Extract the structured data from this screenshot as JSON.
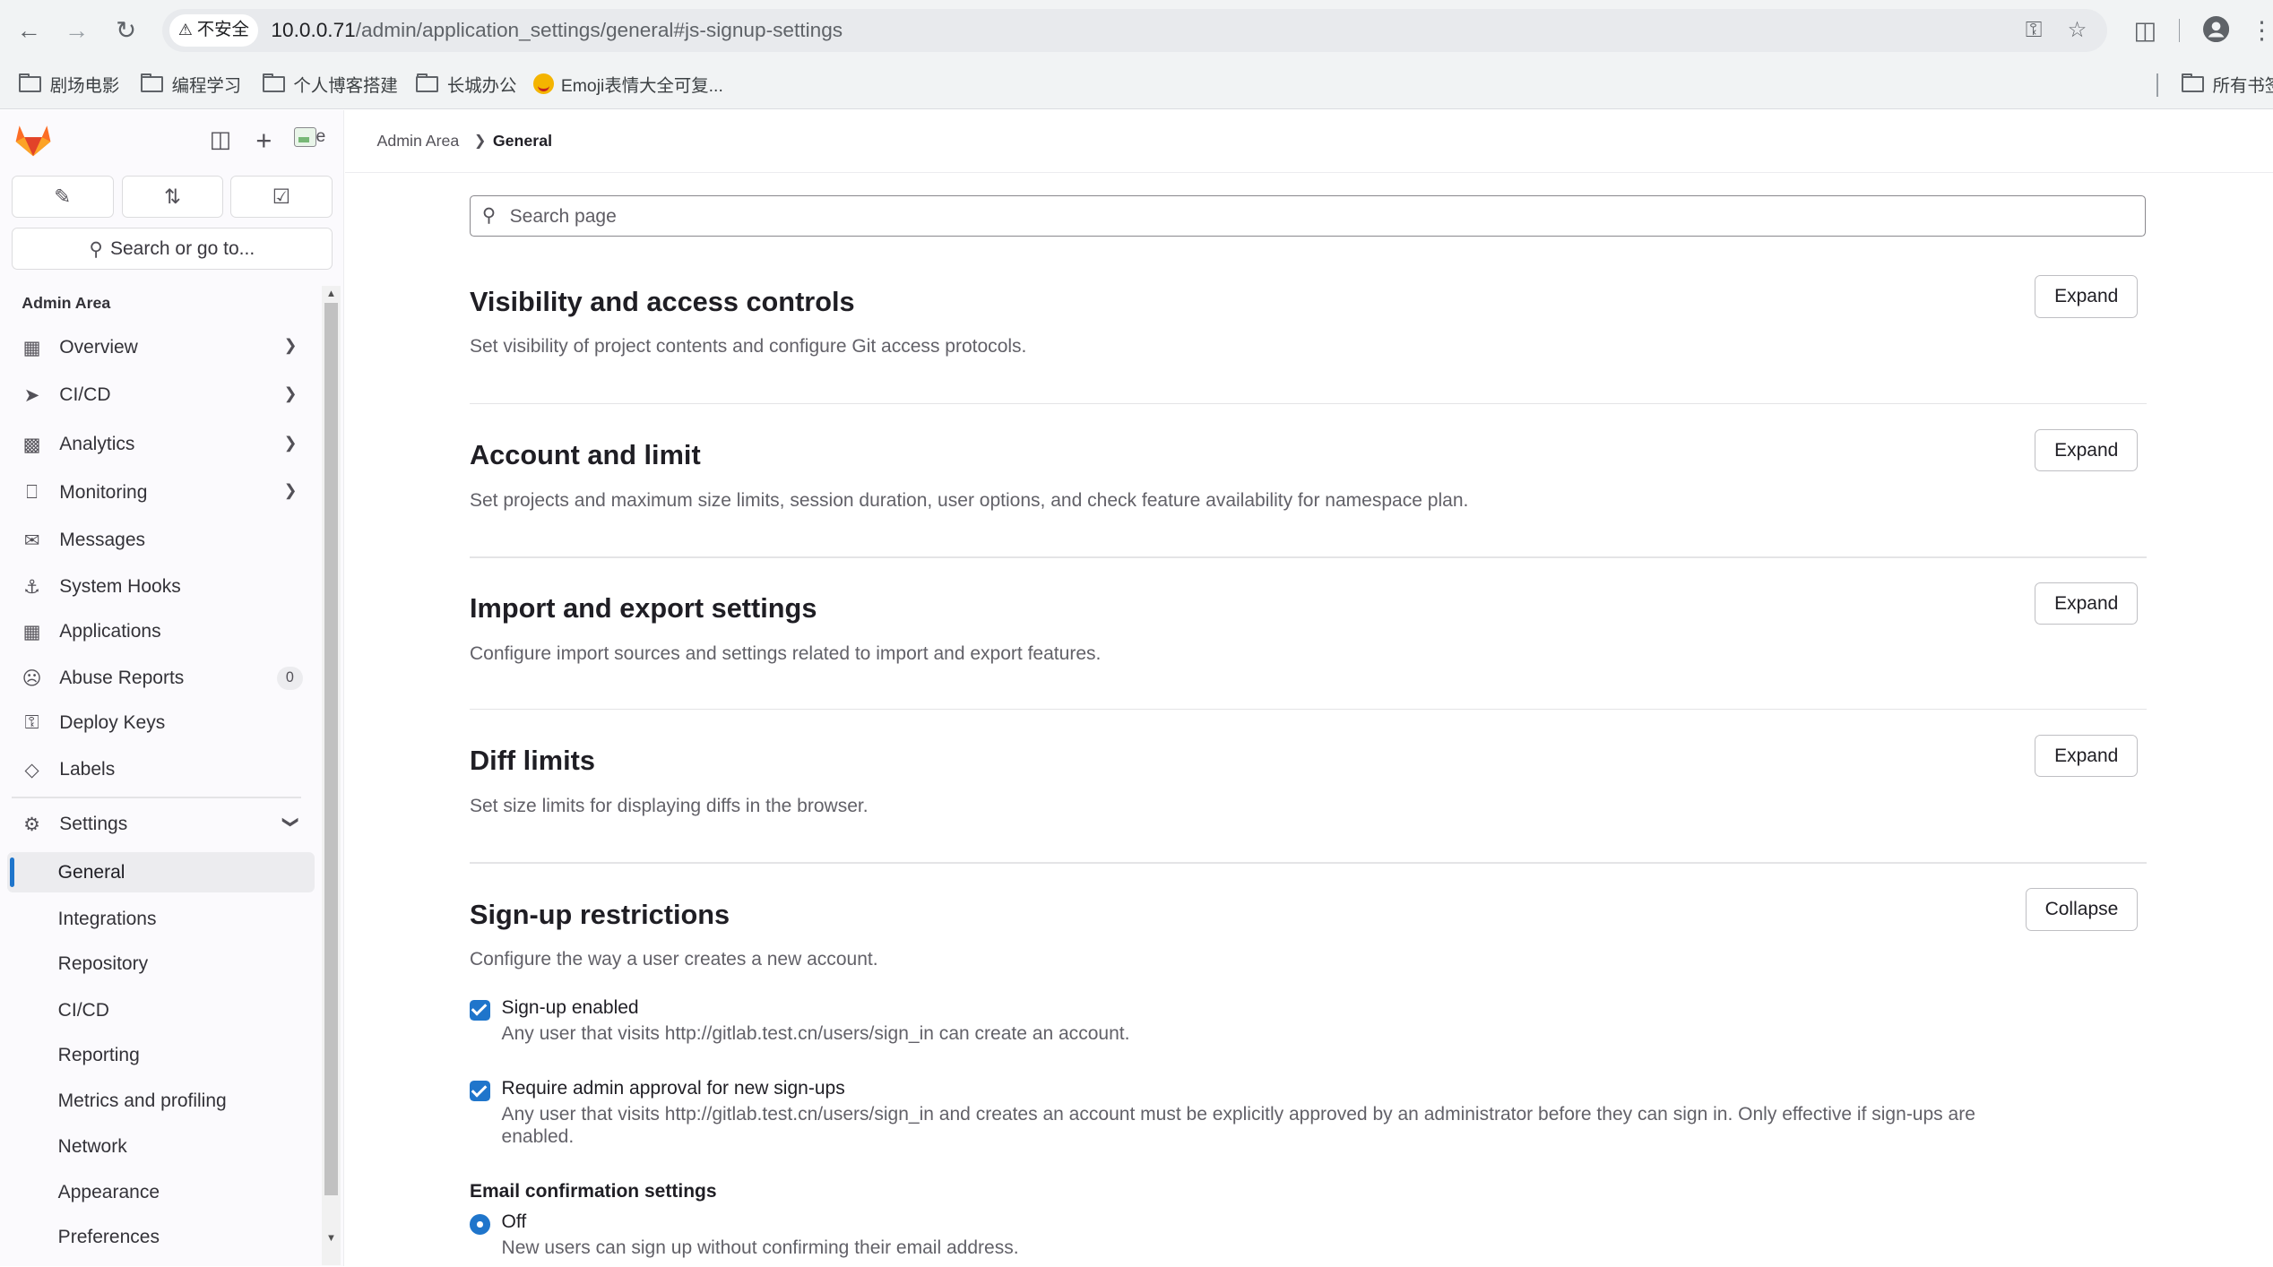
{
  "browser": {
    "security_chip": "不安全",
    "url_host": "10.0.0.71",
    "url_path": "/admin/application_settings/general#js-signup-settings",
    "bookmarks": [
      "剧场电影",
      "编程学习",
      "个人博客搭建",
      "长城办公",
      "Emoji表情大全可复..."
    ],
    "all_bookmarks": "所有书签"
  },
  "sidebar": {
    "avatar_alt": "e",
    "search_label": "Search or go to...",
    "section_title": "Admin Area",
    "items": [
      {
        "label": "Overview",
        "icon": "overview-icon",
        "chevron": true
      },
      {
        "label": "CI/CD",
        "icon": "rocket-icon",
        "chevron": true
      },
      {
        "label": "Analytics",
        "icon": "chart-icon",
        "chevron": true
      },
      {
        "label": "Monitoring",
        "icon": "monitor-icon",
        "chevron": true
      },
      {
        "label": "Messages",
        "icon": "megaphone-icon"
      },
      {
        "label": "System Hooks",
        "icon": "anchor-icon"
      },
      {
        "label": "Applications",
        "icon": "applications-icon"
      },
      {
        "label": "Abuse Reports",
        "icon": "abuse-icon",
        "badge": "0"
      },
      {
        "label": "Deploy Keys",
        "icon": "key-icon"
      },
      {
        "label": "Labels",
        "icon": "label-icon"
      }
    ],
    "settings": {
      "label": "Settings",
      "sub_items": [
        "General",
        "Integrations",
        "Repository",
        "CI/CD",
        "Reporting",
        "Metrics and profiling",
        "Network",
        "Appearance",
        "Preferences"
      ]
    }
  },
  "breadcrumb": {
    "parent": "Admin Area",
    "current": "General"
  },
  "search": {
    "placeholder": "Search page"
  },
  "sections": [
    {
      "title": "Visibility and access controls",
      "desc": "Set visibility of project contents and configure Git access protocols.",
      "button": "Expand"
    },
    {
      "title": "Account and limit",
      "desc": "Set projects and maximum size limits, session duration, user options, and check feature availability for namespace plan.",
      "button": "Expand"
    },
    {
      "title": "Import and export settings",
      "desc": "Configure import sources and settings related to import and export features.",
      "button": "Expand"
    },
    {
      "title": "Diff limits",
      "desc": "Set size limits for displaying diffs in the browser.",
      "button": "Expand"
    },
    {
      "title": "Sign-up restrictions",
      "desc": "Configure the way a user creates a new account.",
      "button": "Collapse"
    }
  ],
  "signup": {
    "signup_enabled": {
      "label": "Sign-up enabled",
      "help": "Any user that visits http://gitlab.test.cn/users/sign_in can create an account.",
      "checked": true
    },
    "admin_approval": {
      "label": "Require admin approval for new sign-ups",
      "help": "Any user that visits http://gitlab.test.cn/users/sign_in and creates an account must be explicitly approved by an administrator before they can sign in. Only effective if sign-ups are enabled.",
      "checked": true
    },
    "email_confirmation": {
      "heading": "Email confirmation settings",
      "selected_label": "Off",
      "selected_help": "New users can sign up without confirming their email address."
    }
  },
  "colors": {
    "accent": "#1f75cb",
    "brand_orange": "#fc6d26",
    "sidebar_bg": "#fbfafd"
  }
}
